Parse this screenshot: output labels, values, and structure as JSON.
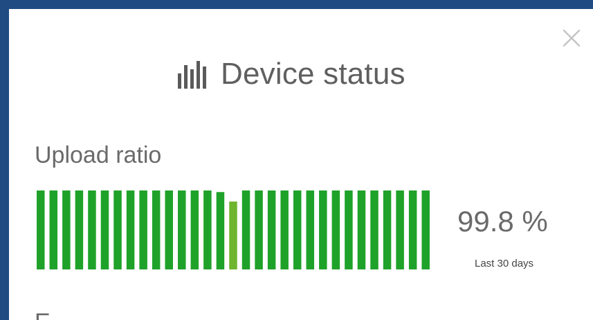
{
  "dialog": {
    "title": "Device status",
    "title_icon": "bar-chart-icon",
    "close_icon": "close-icon"
  },
  "upload": {
    "label": "Upload ratio",
    "value": "99.8 %",
    "caption": "Last 30 days",
    "daily_ratios": [
      1,
      1,
      1,
      1,
      1,
      1,
      1,
      1,
      1,
      1,
      1,
      1,
      1,
      1,
      0.98,
      0.86,
      1,
      1,
      1,
      1,
      1,
      1,
      1,
      1,
      1,
      1,
      1,
      1,
      1,
      1,
      1
    ],
    "colors": {
      "good": "#1fa229",
      "partial": "#6fb530"
    }
  },
  "next_section": {
    "label": "E"
  }
}
